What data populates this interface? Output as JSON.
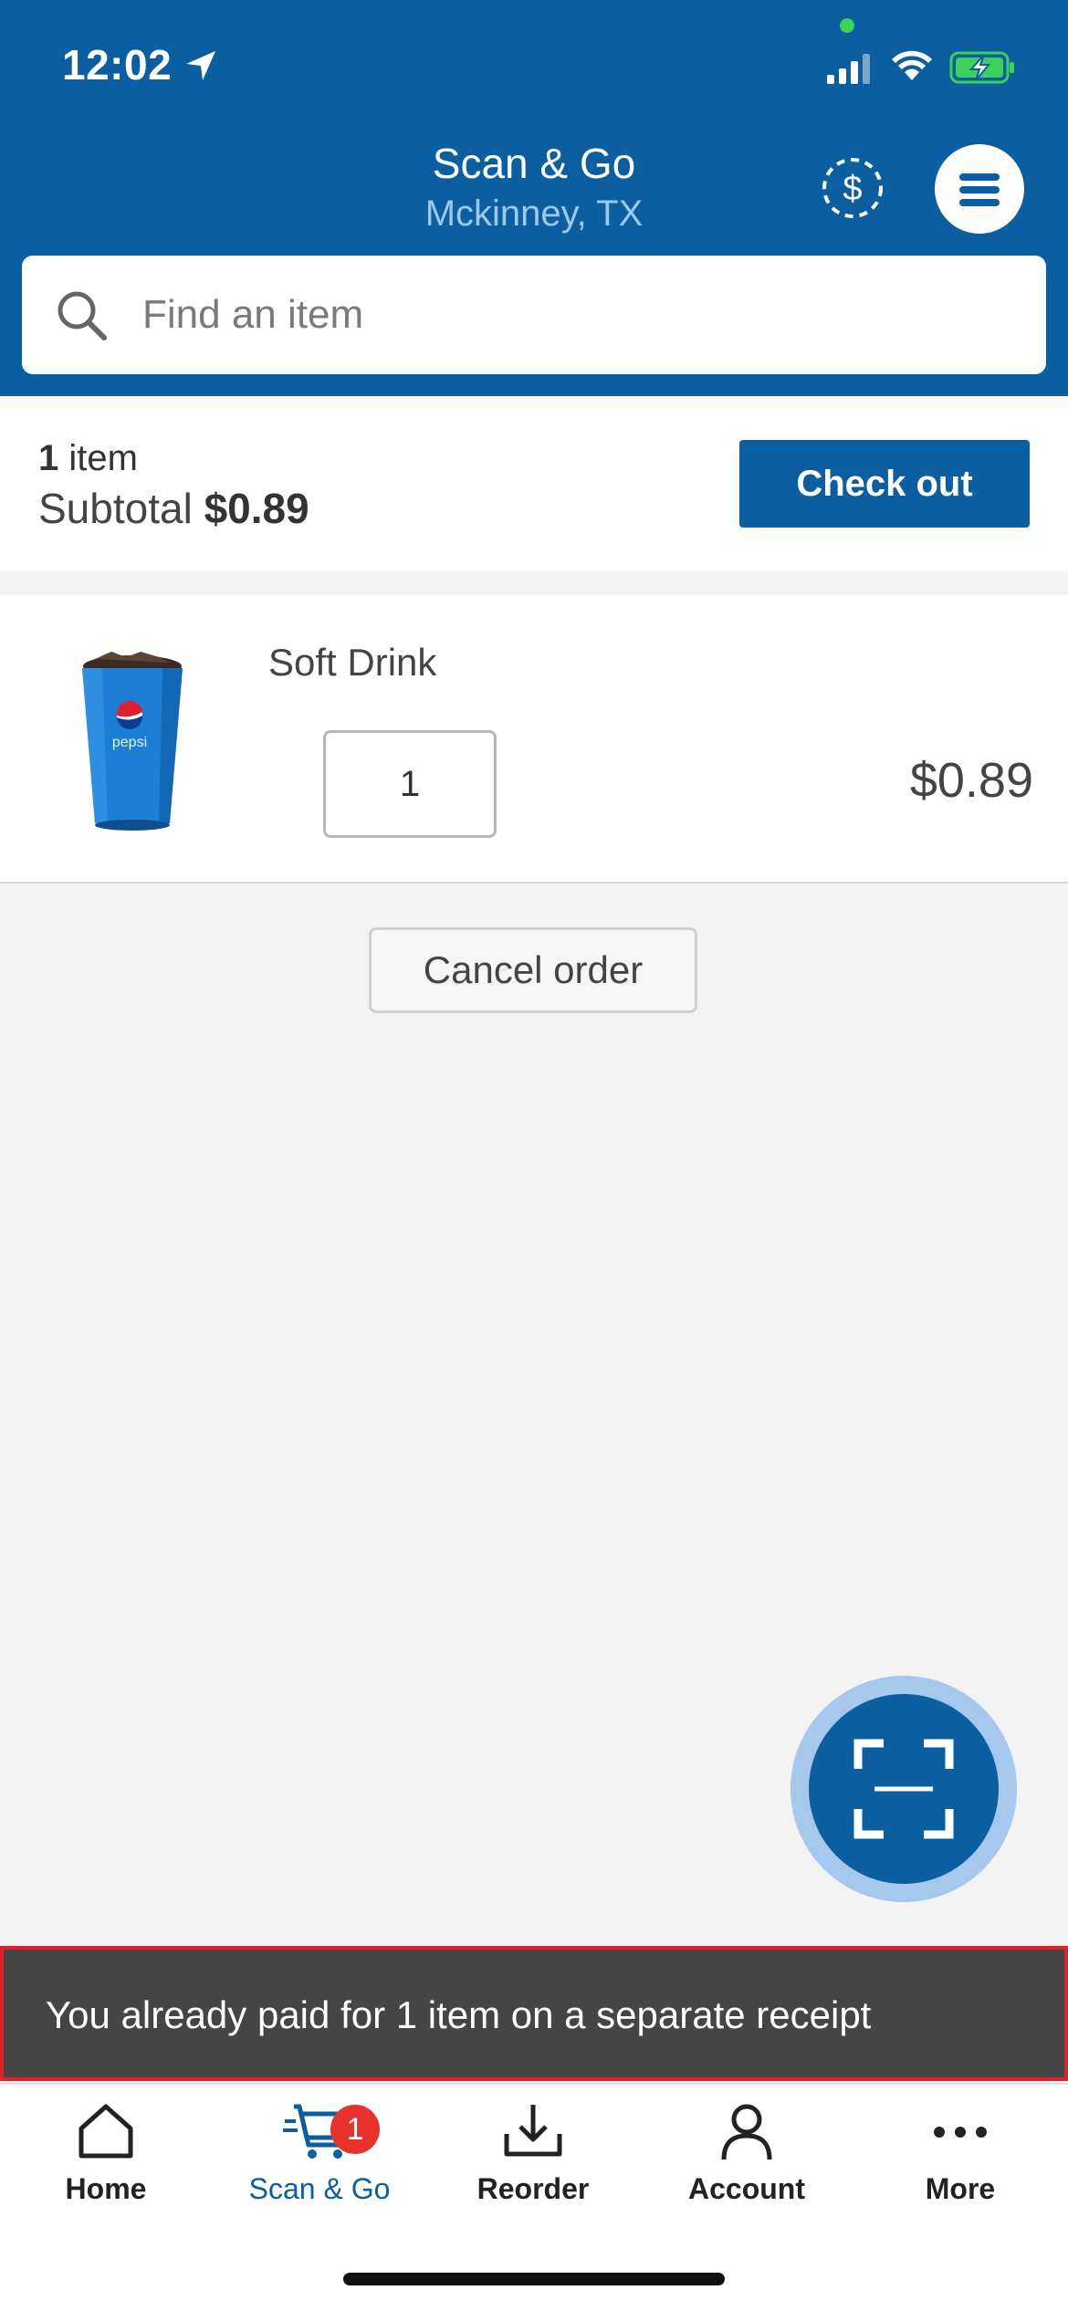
{
  "status_bar": {
    "time": "12:02"
  },
  "header": {
    "title": "Scan & Go",
    "subtitle": "Mckinney, TX"
  },
  "search": {
    "placeholder": "Find an item"
  },
  "summary": {
    "item_count": "1",
    "item_word": "item",
    "subtotal_label": "Subtotal",
    "subtotal_value": "$0.89",
    "checkout_label": "Check out"
  },
  "cart": {
    "items": [
      {
        "name": "Soft Drink",
        "quantity": "1",
        "price": "$0.89",
        "image_brand": "pepsi"
      }
    ]
  },
  "cancel_label": "Cancel order",
  "toast": {
    "message": "You already paid for 1 item on a separate receipt"
  },
  "tabs": [
    {
      "label": "Home",
      "icon": "home-icon"
    },
    {
      "label": "Scan & Go",
      "icon": "cart-icon",
      "badge": "1",
      "active": true
    },
    {
      "label": "Reorder",
      "icon": "reorder-icon"
    },
    {
      "label": "Account",
      "icon": "account-icon"
    },
    {
      "label": "More",
      "icon": "more-icon"
    }
  ],
  "colors": {
    "brand": "#0b5fa0",
    "badge": "#e8322e",
    "toast_bg": "#454545",
    "toast_border": "#e0202a"
  }
}
